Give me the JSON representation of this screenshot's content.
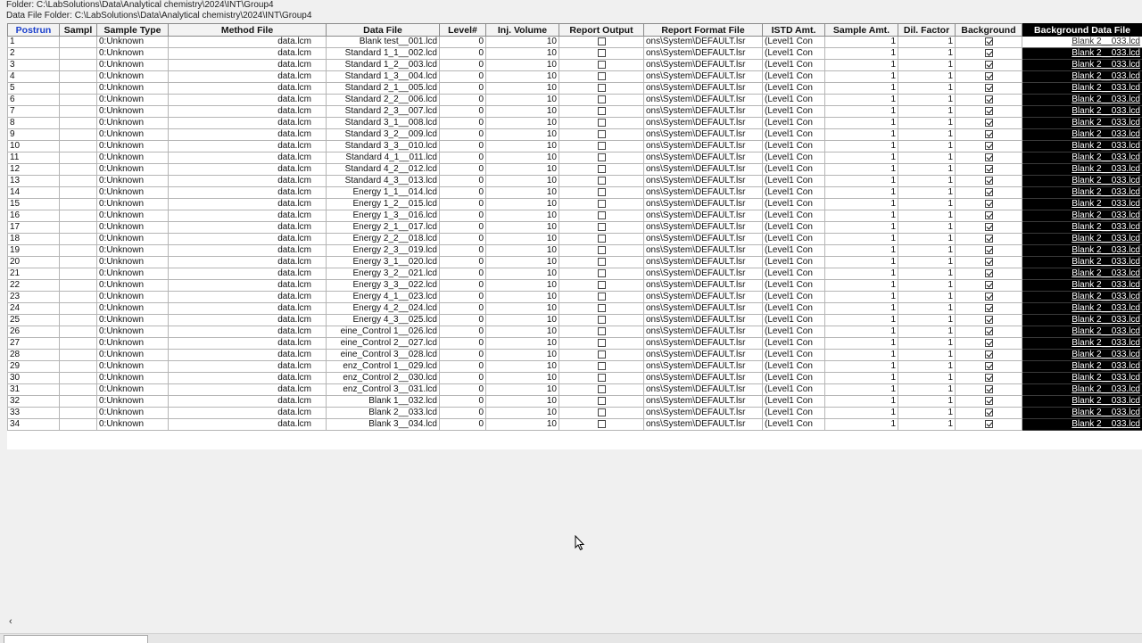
{
  "folder": "Folder: C:\\LabSolutions\\Data\\Analytical chemistry\\2024\\INT\\Group4",
  "data_file_folder": "Data File Folder: C:\\LabSolutions\\Data\\Analytical chemistry\\2024\\INT\\Group4",
  "columns": [
    "Postrun",
    "Sampl",
    "Sample Type",
    "Method File",
    "Data File",
    "Level#",
    "Inj. Volume",
    "Report Output",
    "Report Format File",
    "ISTD Amt.",
    "Sample Amt.",
    "Dil. Factor",
    "Background",
    "Background Data File"
  ],
  "common": {
    "sample_type": "0:Unknown",
    "method_file": "data.lcm",
    "level": "0",
    "inj_volume": "10",
    "report_format": "ons\\System\\DEFAULT.lsr",
    "istd": "(Level1 Con",
    "sample_amt": "1",
    "dil_factor": "1",
    "background_file": "Blank 2__033.lcd"
  },
  "rows": [
    {
      "postrun": "1",
      "data_file": "Blank test__001.lcd"
    },
    {
      "postrun": "2",
      "data_file": "Standard 1_1__002.lcd"
    },
    {
      "postrun": "3",
      "data_file": "Standard 1_2__003.lcd"
    },
    {
      "postrun": "4",
      "data_file": "Standard 1_3__004.lcd"
    },
    {
      "postrun": "5",
      "data_file": "Standard 2_1__005.lcd"
    },
    {
      "postrun": "6",
      "data_file": "Standard 2_2__006.lcd"
    },
    {
      "postrun": "7",
      "data_file": "Standard 2_3__007.lcd"
    },
    {
      "postrun": "8",
      "data_file": "Standard 3_1__008.lcd"
    },
    {
      "postrun": "9",
      "data_file": "Standard 3_2__009.lcd"
    },
    {
      "postrun": "10",
      "data_file": "Standard 3_3__010.lcd"
    },
    {
      "postrun": "11",
      "data_file": "Standard 4_1__011.lcd"
    },
    {
      "postrun": "12",
      "data_file": "Standard 4_2__012.lcd"
    },
    {
      "postrun": "13",
      "data_file": "Standard 4_3__013.lcd"
    },
    {
      "postrun": "14",
      "data_file": "Energy 1_1__014.lcd"
    },
    {
      "postrun": "15",
      "data_file": "Energy 1_2__015.lcd"
    },
    {
      "postrun": "16",
      "data_file": "Energy 1_3__016.lcd"
    },
    {
      "postrun": "17",
      "data_file": "Energy 2_1__017.lcd"
    },
    {
      "postrun": "18",
      "data_file": "Energy 2_2__018.lcd"
    },
    {
      "postrun": "19",
      "data_file": "Energy 2_3__019.lcd"
    },
    {
      "postrun": "20",
      "data_file": "Energy 3_1__020.lcd"
    },
    {
      "postrun": "21",
      "data_file": "Energy 3_2__021.lcd"
    },
    {
      "postrun": "22",
      "data_file": "Energy 3_3__022.lcd"
    },
    {
      "postrun": "23",
      "data_file": "Energy 4_1__023.lcd"
    },
    {
      "postrun": "24",
      "data_file": "Energy 4_2__024.lcd"
    },
    {
      "postrun": "25",
      "data_file": "Energy 4_3__025.lcd"
    },
    {
      "postrun": "26",
      "data_file": "eine_Control 1__026.lcd"
    },
    {
      "postrun": "27",
      "data_file": "eine_Control 2__027.lcd"
    },
    {
      "postrun": "28",
      "data_file": "eine_Control 3__028.lcd"
    },
    {
      "postrun": "29",
      "data_file": "enz_Control 1__029.lcd"
    },
    {
      "postrun": "30",
      "data_file": "enz_Control 2__030.lcd"
    },
    {
      "postrun": "31",
      "data_file": "enz_Control 3__031.lcd"
    },
    {
      "postrun": "32",
      "data_file": "Blank 1__032.lcd"
    },
    {
      "postrun": "33",
      "data_file": "Blank 2__033.lcd"
    },
    {
      "postrun": "34",
      "data_file": "Blank 3__034.lcd"
    }
  ],
  "colors": {
    "active_header": "#1a3fcc",
    "selected_column_bg": "#000000",
    "selected_column_fg": "#ffffff"
  },
  "icons": {
    "scroll_left": "‹",
    "cursor": "mouse-pointer-icon"
  }
}
